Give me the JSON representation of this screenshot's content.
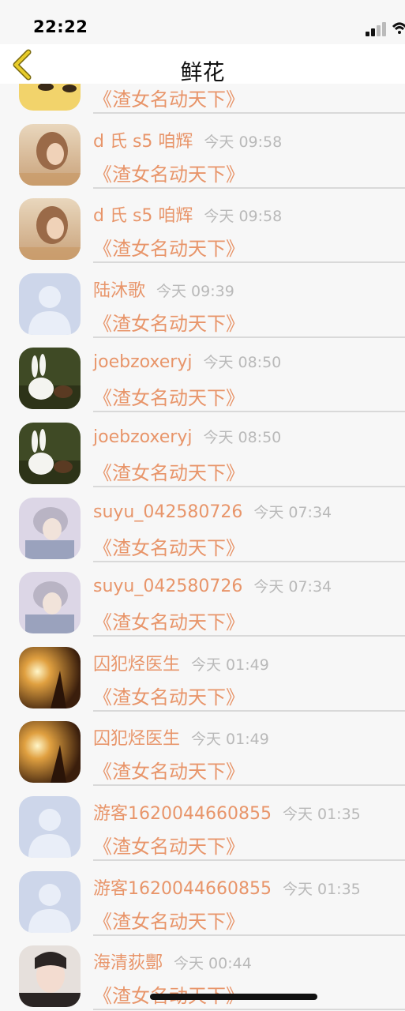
{
  "status": {
    "time": "22:22"
  },
  "nav": {
    "title": "鲜花"
  },
  "rows": [
    {
      "name": "",
      "time": "",
      "book": "《渣女名动天下》",
      "avatar": "pattern"
    },
    {
      "name": "d 氏 s5 咱辉",
      "time": "今天 09:58",
      "book": "《渣女名动天下》",
      "avatar": "girl"
    },
    {
      "name": "d 氏 s5 咱辉",
      "time": "今天 09:58",
      "book": "《渣女名动天下》",
      "avatar": "girl"
    },
    {
      "name": "陆沐歌",
      "time": "今天 09:39",
      "book": "《渣女名动天下》",
      "avatar": "default"
    },
    {
      "name": "joebzoxeryj",
      "time": "今天 08:50",
      "book": "《渣女名动天下》",
      "avatar": "rabbit"
    },
    {
      "name": "joebzoxeryj",
      "time": "今天 08:50",
      "book": "《渣女名动天下》",
      "avatar": "rabbit"
    },
    {
      "name": "suyu_042580726",
      "time": "今天 07:34",
      "book": "《渣女名动天下》",
      "avatar": "anime"
    },
    {
      "name": "suyu_042580726",
      "time": "今天 07:34",
      "book": "《渣女名动天下》",
      "avatar": "anime"
    },
    {
      "name": "囚犯烃医生",
      "time": "今天 01:49",
      "book": "《渣女名动天下》",
      "avatar": "sunset"
    },
    {
      "name": "囚犯烃医生",
      "time": "今天 01:49",
      "book": "《渣女名动天下》",
      "avatar": "sunset"
    },
    {
      "name": "游客1620044660855",
      "time": "今天 01:35",
      "book": "《渣女名动天下》",
      "avatar": "default"
    },
    {
      "name": "游客1620044660855",
      "time": "今天 01:35",
      "book": "《渣女名动天下》",
      "avatar": "default"
    },
    {
      "name": "海清荻酆",
      "time": "今天 00:44",
      "book": "《渣女名动天下》",
      "avatar": "photo"
    }
  ],
  "colors": {
    "accent": "#e8956a",
    "time": "#b9b9b9",
    "back": "#e0c21a"
  }
}
